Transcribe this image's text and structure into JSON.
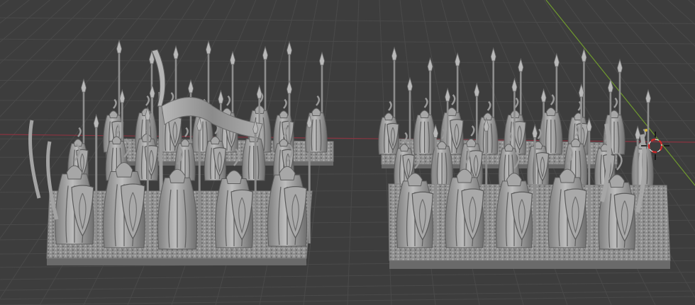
{
  "scene": {
    "background_color": "#3d3d3d",
    "grid_color": "#4a4a4a",
    "x_axis_color": "#8a3340",
    "y_axis_color": "#6f9a2e",
    "model_color": "#9a9a9a",
    "model_shadow_color": "#5e5e5e",
    "model_highlight_color": "#c4c4c4",
    "base_color": "#8e8e8e",
    "base_side_color": "#6a6a6a"
  },
  "regiments": [
    {
      "name": "command-regiment",
      "has_banner": true,
      "figures_visible": "front-rank"
    },
    {
      "name": "spear-regiment",
      "has_banner": false,
      "figures_visible": "front-rank"
    }
  ],
  "cursor": {
    "icon": "3d-cursor-icon",
    "fill": "#ffffff",
    "accent": "#d02a2a"
  }
}
